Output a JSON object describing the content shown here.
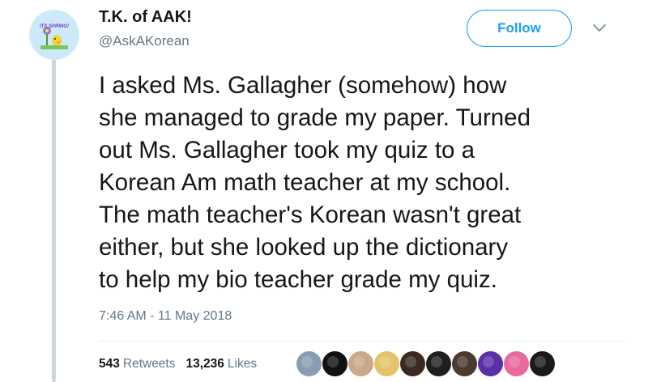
{
  "author": {
    "name": "T.K. of AAK!",
    "handle": "@AskAKorean",
    "avatar_text": "ITS SPRING!"
  },
  "follow_button": {
    "label": "Follow"
  },
  "menu": {
    "icon": "chevron-down-icon"
  },
  "tweet": {
    "lines": [
      "I asked Ms. Gallagher (somehow) how",
      "she managed to grade my paper. Turned",
      "out Ms. Gallagher took my quiz to a",
      "Korean Am math teacher at my school.",
      "The math teacher's Korean wasn't great",
      "either, but she looked up the dictionary",
      "to help my bio teacher grade my quiz."
    ],
    "timestamp": "7:46 AM - 11 May 2018"
  },
  "stats": {
    "retweets_count": "543",
    "retweets_label": "Retweets",
    "likes_count": "13,236",
    "likes_label": "Likes"
  },
  "liked_by_avatars": [
    {
      "name": "liker-avatar-1",
      "color": "#8a9bb4"
    },
    {
      "name": "liker-avatar-2",
      "color": "#111111"
    },
    {
      "name": "liker-avatar-3",
      "color": "#c9a98a"
    },
    {
      "name": "liker-avatar-4",
      "color": "#e3c46a"
    },
    {
      "name": "liker-avatar-5",
      "color": "#3a2a22"
    },
    {
      "name": "liker-avatar-6",
      "color": "#1f1f1f"
    },
    {
      "name": "liker-avatar-7",
      "color": "#4b3a2e"
    },
    {
      "name": "liker-avatar-8",
      "color": "#5a2fa8"
    },
    {
      "name": "liker-avatar-9",
      "color": "#e86aa0"
    },
    {
      "name": "liker-avatar-10",
      "color": "#1a1a1a"
    }
  ],
  "colors": {
    "accent": "#1da1f2",
    "secondary_text": "#657786",
    "primary_text": "#14171a"
  }
}
